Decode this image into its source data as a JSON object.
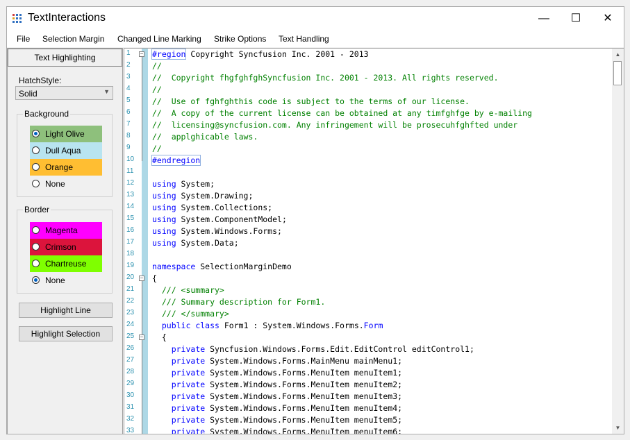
{
  "window": {
    "title": "TextInteractions",
    "controls": [
      "—",
      "☐",
      "✕"
    ]
  },
  "menu": [
    "File",
    "Selection Margin",
    "Changed Line Marking",
    "Strike Options",
    "Text Handling"
  ],
  "left": {
    "tab": "Text Highlighting",
    "hatch_label": "HatchStyle:",
    "hatch_value": "Solid",
    "background": {
      "title": "Background",
      "options": [
        {
          "label": "Light Olive",
          "color": "#8ec07c",
          "checked": true
        },
        {
          "label": "Dull Aqua",
          "color": "#b8e4f0",
          "checked": false
        },
        {
          "label": "Orange",
          "color": "#ffbe32",
          "checked": false
        },
        {
          "label": "None",
          "color": "",
          "checked": false
        }
      ]
    },
    "border": {
      "title": "Border",
      "options": [
        {
          "label": "Magenta",
          "color": "#ff00ff",
          "checked": false
        },
        {
          "label": "Crimson",
          "color": "#dc143c",
          "checked": false
        },
        {
          "label": "Chartreuse",
          "color": "#7fff00",
          "checked": false
        },
        {
          "label": "None",
          "color": "",
          "checked": true
        }
      ]
    },
    "highlight_line": "Highlight Line",
    "highlight_selection": "Highlight Selection"
  },
  "code_lines": [
    {
      "n": "1",
      "segs": [
        [
          "box kw",
          "#region"
        ],
        [
          "",
          " Copyright Syncfusion Inc. 2001 - 2013"
        ]
      ]
    },
    {
      "n": "2",
      "segs": [
        [
          "cmt",
          "//"
        ]
      ]
    },
    {
      "n": "3",
      "segs": [
        [
          "cmt",
          "//  Copyright fhgfghfghSyncfusion Inc. 2001 - 2013. All rights reserved."
        ]
      ]
    },
    {
      "n": "4",
      "segs": [
        [
          "cmt",
          "//"
        ]
      ]
    },
    {
      "n": "5",
      "segs": [
        [
          "cmt",
          "//  Use of fghfghthis code is subject to the terms of our license."
        ]
      ]
    },
    {
      "n": "6",
      "segs": [
        [
          "cmt",
          "//  A copy of the current license can be obtained at any timfghfge by e-mailing"
        ]
      ]
    },
    {
      "n": "7",
      "segs": [
        [
          "cmt",
          "//  licensing@syncfusion.com. Any infringement will be prosecuhfghfted under"
        ]
      ]
    },
    {
      "n": "8",
      "segs": [
        [
          "cmt",
          "//  applghicable laws."
        ]
      ]
    },
    {
      "n": "9",
      "segs": [
        [
          "cmt",
          "//"
        ]
      ]
    },
    {
      "n": "10",
      "segs": [
        [
          "box kw",
          "#endregion"
        ]
      ]
    },
    {
      "n": "11",
      "segs": []
    },
    {
      "n": "12",
      "segs": [
        [
          "kw",
          "using"
        ],
        [
          "",
          " System;"
        ]
      ]
    },
    {
      "n": "13",
      "segs": [
        [
          "kw",
          "using"
        ],
        [
          "",
          " System.Drawing;"
        ]
      ]
    },
    {
      "n": "14",
      "segs": [
        [
          "kw",
          "using"
        ],
        [
          "",
          " System.Collections;"
        ]
      ]
    },
    {
      "n": "15",
      "segs": [
        [
          "kw",
          "using"
        ],
        [
          "",
          " System.ComponentModel;"
        ]
      ]
    },
    {
      "n": "16",
      "segs": [
        [
          "kw",
          "using"
        ],
        [
          "",
          " System.Windows.Forms;"
        ]
      ]
    },
    {
      "n": "17",
      "segs": [
        [
          "kw",
          "using"
        ],
        [
          "",
          " System.Data;"
        ]
      ]
    },
    {
      "n": "18",
      "segs": []
    },
    {
      "n": "19",
      "segs": [
        [
          "kw",
          "namespace"
        ],
        [
          "",
          " SelectionMarginDemo"
        ]
      ]
    },
    {
      "n": "20",
      "segs": [
        [
          "",
          "{"
        ]
      ]
    },
    {
      "n": "21",
      "segs": [
        [
          "cmt",
          "  /// <summary>"
        ]
      ]
    },
    {
      "n": "22",
      "segs": [
        [
          "cmt",
          "  /// Summary description for Form1."
        ]
      ]
    },
    {
      "n": "23",
      "segs": [
        [
          "cmt",
          "  /// </summary>"
        ]
      ]
    },
    {
      "n": "24",
      "segs": [
        [
          "",
          "  "
        ],
        [
          "kw",
          "public class"
        ],
        [
          "",
          " Form1 : System.Windows.Forms."
        ],
        [
          "kw",
          "Form"
        ]
      ]
    },
    {
      "n": "25",
      "segs": [
        [
          "",
          "  {"
        ]
      ]
    },
    {
      "n": "26",
      "segs": [
        [
          "",
          "    "
        ],
        [
          "kw",
          "private"
        ],
        [
          "",
          " Syncfusion.Windows.Forms.Edit.EditControl editControl1;"
        ]
      ]
    },
    {
      "n": "27",
      "segs": [
        [
          "",
          "    "
        ],
        [
          "kw",
          "private"
        ],
        [
          "",
          " System.Windows.Forms.MainMenu mainMenu1;"
        ]
      ]
    },
    {
      "n": "28",
      "segs": [
        [
          "",
          "    "
        ],
        [
          "kw",
          "private"
        ],
        [
          "",
          " System.Windows.Forms.MenuItem menuItem1;"
        ]
      ]
    },
    {
      "n": "29",
      "segs": [
        [
          "",
          "    "
        ],
        [
          "kw",
          "private"
        ],
        [
          "",
          " System.Windows.Forms.MenuItem menuItem2;"
        ]
      ]
    },
    {
      "n": "30",
      "segs": [
        [
          "",
          "    "
        ],
        [
          "kw",
          "private"
        ],
        [
          "",
          " System.Windows.Forms.MenuItem menuItem3;"
        ]
      ]
    },
    {
      "n": "31",
      "segs": [
        [
          "",
          "    "
        ],
        [
          "kw",
          "private"
        ],
        [
          "",
          " System.Windows.Forms.MenuItem menuItem4;"
        ]
      ]
    },
    {
      "n": "32",
      "segs": [
        [
          "",
          "    "
        ],
        [
          "kw",
          "private"
        ],
        [
          "",
          " System.Windows.Forms.MenuItem menuItem5;"
        ]
      ]
    },
    {
      "n": "33",
      "segs": [
        [
          "",
          "    "
        ],
        [
          "kw",
          "private"
        ],
        [
          "",
          " System.Windows.Forms.MenuItem menuItem6;"
        ]
      ]
    }
  ]
}
